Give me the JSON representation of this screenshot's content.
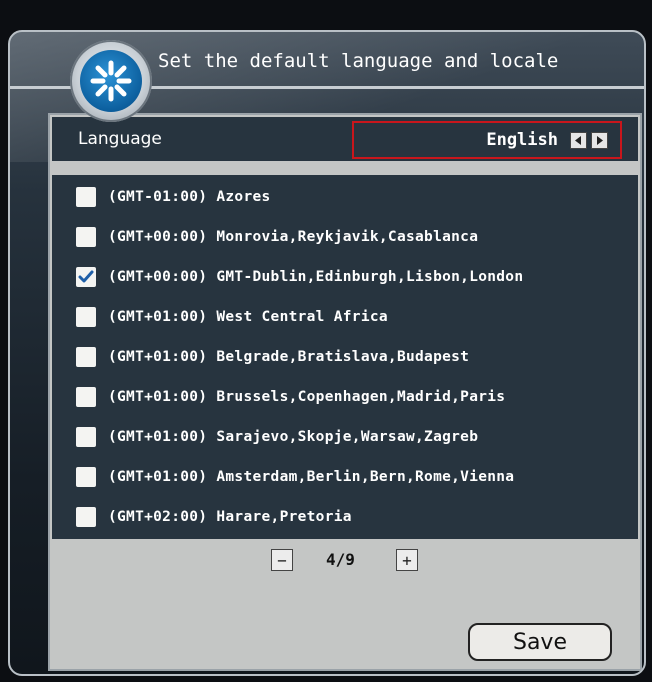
{
  "header": {
    "title": "Set the default language and locale"
  },
  "language": {
    "label": "Language",
    "value": "English"
  },
  "timezones": [
    {
      "label": "(GMT-01:00) Azores",
      "checked": false
    },
    {
      "label": "(GMT+00:00) Monrovia,Reykjavik,Casablanca",
      "checked": false
    },
    {
      "label": "(GMT+00:00) GMT-Dublin,Edinburgh,Lisbon,London",
      "checked": true
    },
    {
      "label": "(GMT+01:00) West Central Africa",
      "checked": false
    },
    {
      "label": "(GMT+01:00) Belgrade,Bratislava,Budapest",
      "checked": false
    },
    {
      "label": "(GMT+01:00) Brussels,Copenhagen,Madrid,Paris",
      "checked": false
    },
    {
      "label": "(GMT+01:00) Sarajevo,Skopje,Warsaw,Zagreb",
      "checked": false
    },
    {
      "label": "(GMT+01:00) Amsterdam,Berlin,Bern,Rome,Vienna",
      "checked": false
    },
    {
      "label": "(GMT+02:00) Harare,Pretoria",
      "checked": false
    }
  ],
  "pager": {
    "minus": "−",
    "plus": "+",
    "page": "4/9"
  },
  "save_label": "Save",
  "colors": {
    "panel_dark": "#27343f",
    "panel_light": "#c4c6c5",
    "highlight": "#c8161c",
    "check": "#1f5fa8"
  }
}
